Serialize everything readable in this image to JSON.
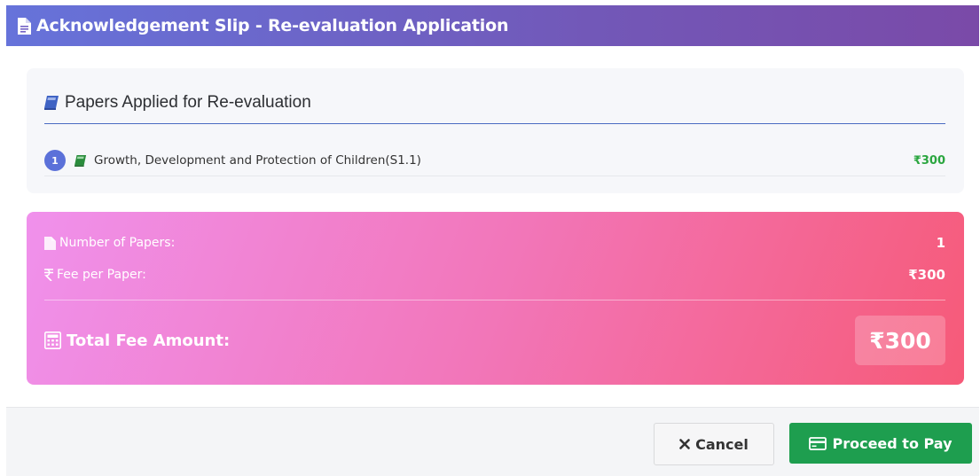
{
  "header": {
    "title": "Acknowledgement Slip - Re-evaluation Application",
    "icon": "document-icon"
  },
  "papers": {
    "heading": "Papers Applied for Re-evaluation",
    "items": [
      {
        "index": "1",
        "name": "Growth, Development and Protection of Children(S1.1)",
        "fee": "₹300"
      }
    ]
  },
  "summary": {
    "count_label": "Number of Papers:",
    "count_value": "1",
    "fee_label": "Fee per Paper:",
    "fee_value": "₹300",
    "total_label": "Total Fee Amount:",
    "total_value": "₹300"
  },
  "actions": {
    "cancel_label": "Cancel",
    "pay_label": "Proceed to Pay"
  },
  "colors": {
    "header_start": "#6673da",
    "header_end": "#7a4aa8",
    "accent_green": "#1e9e4f",
    "fee_green": "#2aa63f"
  }
}
